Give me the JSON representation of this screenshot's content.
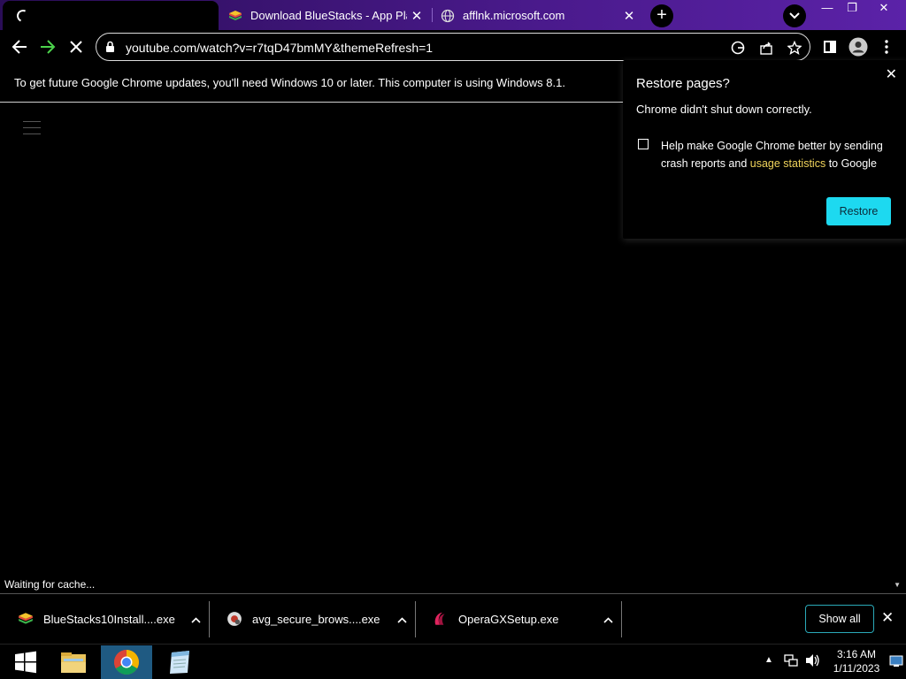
{
  "tabs": [
    {
      "title": "",
      "loading": true,
      "active": true
    },
    {
      "title": "Download BlueStacks - App Playe",
      "icon": "bluestacks-icon"
    },
    {
      "title": "afflnk.microsoft.com",
      "icon": "globe-icon"
    }
  ],
  "window_controls": {
    "minimize": "—",
    "restore": "❐",
    "close": "✕"
  },
  "toolbar": {
    "url": "youtube.com/watch?v=r7tqD47bmMY&themeRefresh=1"
  },
  "infobar": {
    "message": "To get future Google Chrome updates, you'll need Windows 10 or later. This computer is using Windows 8.1."
  },
  "status": {
    "text": "Waiting for cache..."
  },
  "popup": {
    "title": "Restore pages?",
    "subtitle": "Chrome didn't shut down correctly.",
    "checkbox_text_before": "Help make Google Chrome better by sending crash reports and ",
    "checkbox_link": "usage statistics",
    "checkbox_text_after": " to Google",
    "restore_label": "Restore"
  },
  "downloads": [
    {
      "name": "BlueStacks10Install....exe",
      "icon": "bluestacks-icon"
    },
    {
      "name": "avg_secure_brows....exe",
      "icon": "avg-icon"
    },
    {
      "name": "OperaGXSetup.exe",
      "icon": "opera-gx-icon"
    }
  ],
  "shelf": {
    "show_all_label": "Show all"
  },
  "taskbar": {
    "time": "3:16 AM",
    "date": "1/11/2023"
  },
  "colors": {
    "tabstrip": "#4a1a8c",
    "restore_button": "#1dd9f0",
    "link": "#f0d35b",
    "taskbar_active": "#1f5a82"
  }
}
